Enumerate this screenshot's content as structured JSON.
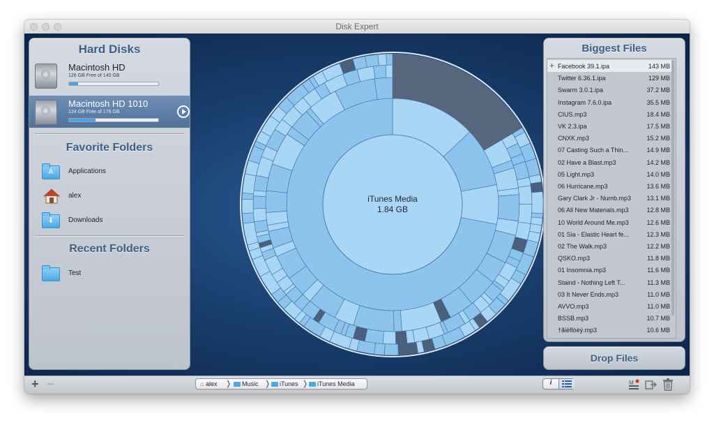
{
  "window": {
    "title": "Disk Expert"
  },
  "hard_disks": {
    "title": "Hard Disks",
    "disks": [
      {
        "name": "Macintosh HD",
        "free_text": "126 GB Free of 140 GB",
        "used_fraction": 0.1
      },
      {
        "name": "Macintosh HD 1010",
        "free_text": "124 GB Free of 178 GB",
        "used_fraction": 0.3
      }
    ]
  },
  "favorite_folders": {
    "title": "Favorite Folders",
    "items": [
      {
        "label": "Applications",
        "icon": "applications-folder-icon"
      },
      {
        "label": "alex",
        "icon": "home-folder-icon"
      },
      {
        "label": "Downloads",
        "icon": "downloads-folder-icon"
      }
    ]
  },
  "recent_folders": {
    "title": "Recent Folders",
    "items": [
      {
        "label": "Test",
        "icon": "folder-icon"
      }
    ]
  },
  "center": {
    "name": "iTunes Media",
    "size": "1.84 GB"
  },
  "biggest_files": {
    "title": "Biggest Files",
    "files": [
      {
        "name": "Facebook 39.1.ipa",
        "size": "143 MB"
      },
      {
        "name": "Twitter 6.36.1.ipa",
        "size": "129 MB"
      },
      {
        "name": "Swarm 3.0.1.ipa",
        "size": "37.2 MB"
      },
      {
        "name": "Instagram 7.6.0.ipa",
        "size": "35.5 MB"
      },
      {
        "name": "CIUS.mp3",
        "size": "18.4 MB"
      },
      {
        "name": "VK 2.3.ipa",
        "size": "17.5 MB"
      },
      {
        "name": "CNXK.mp3",
        "size": "15.2 MB"
      },
      {
        "name": "07 Casting Such a Thin...",
        "size": "14.9 MB"
      },
      {
        "name": "02 Have a Blast.mp3",
        "size": "14.2 MB"
      },
      {
        "name": "05 Light.mp3",
        "size": "14.0 MB"
      },
      {
        "name": "06 Hurricane.mp3",
        "size": "13.6 MB"
      },
      {
        "name": "Gary Clark Jr - Numb.mp3",
        "size": "13.1 MB"
      },
      {
        "name": "06 All New Materials.mp3",
        "size": "12.8 MB"
      },
      {
        "name": "10 World Around Me.mp3",
        "size": "12.6 MB"
      },
      {
        "name": "01 Sia - Elastic Heart fe...",
        "size": "12.3 MB"
      },
      {
        "name": "02 The Walk.mp3",
        "size": "12.2 MB"
      },
      {
        "name": "QSKO.mp3",
        "size": "11.8 MB"
      },
      {
        "name": "01 Insomnia.mp3",
        "size": "11.6 MB"
      },
      {
        "name": "Staind - Nothing Left T...",
        "size": "11.3 MB"
      },
      {
        "name": "03 It Never Ends.mp3",
        "size": "11.0 MB"
      },
      {
        "name": "AVVO.mp3",
        "size": "11.0 MB"
      },
      {
        "name": "BSSB.mp3",
        "size": "10.7 MB"
      },
      {
        "name": "†ãiëflòèý.mp3",
        "size": "10.6 MB"
      }
    ]
  },
  "drop_files": {
    "label": "Drop Files"
  },
  "breadcrumb": [
    {
      "label": "alex",
      "icon": "home-icon"
    },
    {
      "label": "Music",
      "icon": "folder-icon"
    },
    {
      "label": "iTunes",
      "icon": "folder-icon"
    },
    {
      "label": "iTunes Media",
      "icon": "folder-icon"
    }
  ],
  "toolbar": {
    "add_symbol": "+",
    "remove_symbol": "−",
    "info_symbol": "i"
  },
  "colors": {
    "background": "#1b4677",
    "ring_fill": "#8cc4ee",
    "ring_fill_alt": "#a9d6f5",
    "ring_stroke": "#3f6f9f",
    "large_segment": "#56677d",
    "accent": "#4aa3e6"
  }
}
